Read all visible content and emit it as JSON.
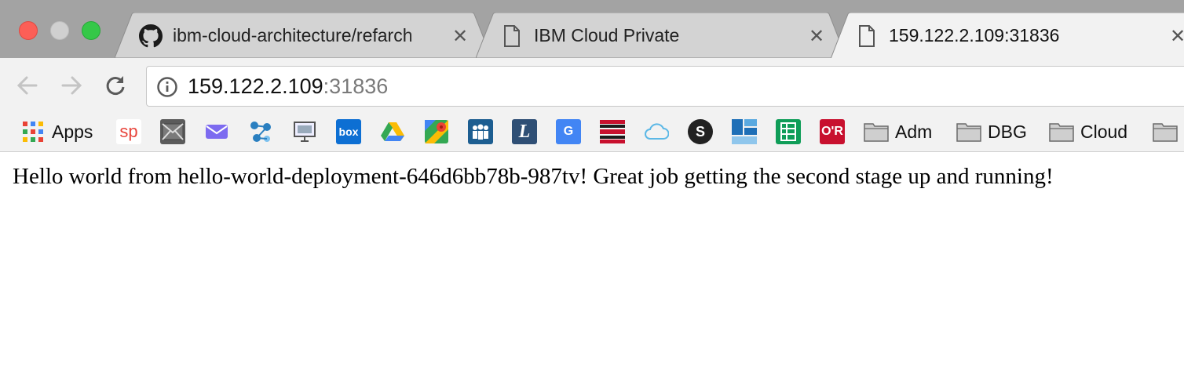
{
  "window": {
    "traffic_lights": [
      "close",
      "minimize",
      "zoom"
    ]
  },
  "tabs": [
    {
      "title": "ibm-cloud-architecture/refarch",
      "icon": "github-icon",
      "active": false
    },
    {
      "title": "IBM Cloud Private",
      "icon": "page-icon",
      "active": false
    },
    {
      "title": "159.122.2.109:31836",
      "icon": "page-icon",
      "active": true
    }
  ],
  "tab_close_glyph": "✕",
  "toolbar": {
    "url_host": "159.122.2.109",
    "url_port": ":31836"
  },
  "bookmarks": [
    {
      "label": "Apps",
      "icon": "apps-grid-icon"
    },
    {
      "label": "",
      "icon": "sp-icon",
      "glyph": "sp"
    },
    {
      "label": "",
      "icon": "mail-icon"
    },
    {
      "label": "",
      "icon": "inbox-icon"
    },
    {
      "label": "",
      "icon": "network-icon"
    },
    {
      "label": "",
      "icon": "monitor-icon"
    },
    {
      "label": "",
      "icon": "box-icon",
      "glyph": "box"
    },
    {
      "label": "",
      "icon": "google-drive-icon"
    },
    {
      "label": "",
      "icon": "google-maps-icon"
    },
    {
      "label": "",
      "icon": "people-icon"
    },
    {
      "label": "",
      "icon": "l-logo-icon",
      "glyph": "L"
    },
    {
      "label": "",
      "icon": "google-translate-icon",
      "glyph": "G"
    },
    {
      "label": "",
      "icon": "stripes-icon"
    },
    {
      "label": "",
      "icon": "cloud-icon"
    },
    {
      "label": "",
      "icon": "s-circle-icon",
      "glyph": "S"
    },
    {
      "label": "",
      "icon": "tiles-icon"
    },
    {
      "label": "",
      "icon": "google-sheets-icon"
    },
    {
      "label": "",
      "icon": "or-icon",
      "glyph": "O'R"
    },
    {
      "label": "Adm",
      "icon": "folder-icon"
    },
    {
      "label": "DBG",
      "icon": "folder-icon"
    },
    {
      "label": "Cloud",
      "icon": "folder-icon"
    },
    {
      "label": "",
      "icon": "folder-icon"
    }
  ],
  "page": {
    "message": "Hello world from hello-world-deployment-646d6bb78b-987tv! Great job getting the second stage up and running!"
  },
  "colors": {
    "tabstrip_bg": "#a3a3a3",
    "toolbar_bg": "#f2f2f2",
    "close_light": "#fc5f57",
    "zoom_light": "#35c848"
  }
}
